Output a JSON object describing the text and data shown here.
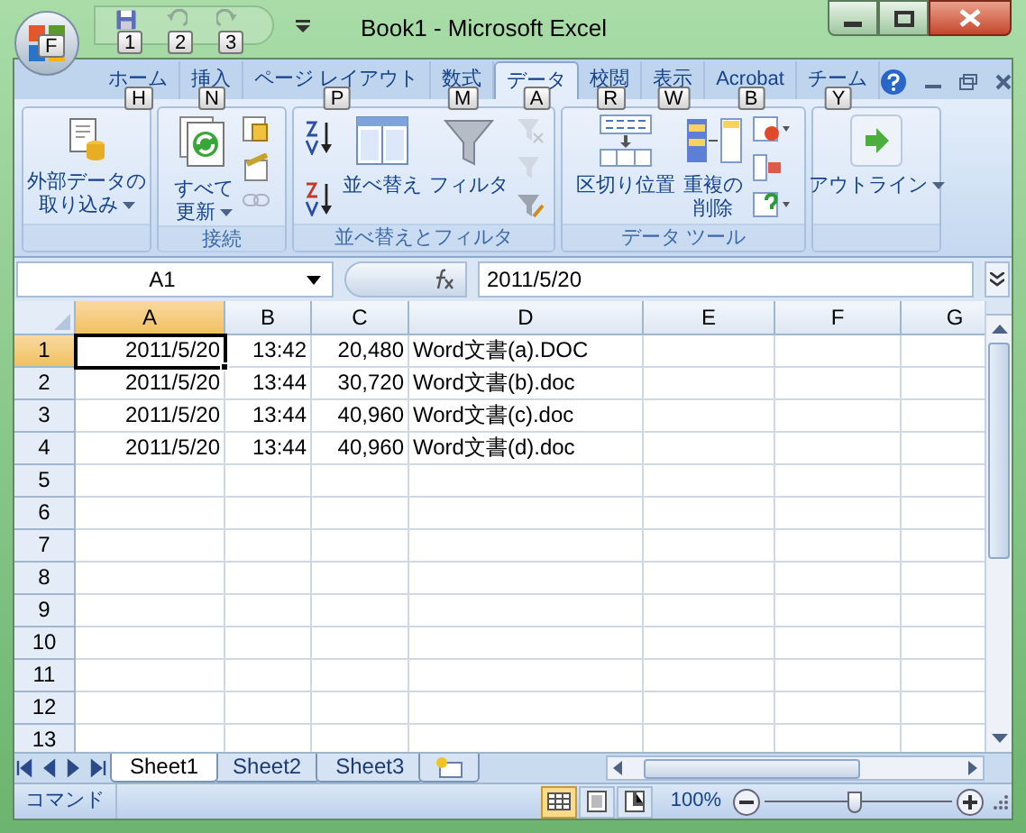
{
  "window": {
    "title": "Book1 - Microsoft Excel"
  },
  "office_button": {
    "keytip": "F"
  },
  "quick_access": [
    {
      "keytip": "1",
      "disabled": false
    },
    {
      "keytip": "2",
      "disabled": true
    },
    {
      "keytip": "3",
      "disabled": true
    }
  ],
  "tabs": [
    {
      "label": "ホーム",
      "keytip": "H",
      "selected": false
    },
    {
      "label": "挿入",
      "keytip": "N",
      "selected": false
    },
    {
      "label": "ページ レイアウト",
      "keytip": "P",
      "selected": false
    },
    {
      "label": "数式",
      "keytip": "M",
      "selected": false
    },
    {
      "label": "データ",
      "keytip": "A",
      "selected": true
    },
    {
      "label": "校閲",
      "keytip": "R",
      "selected": false
    },
    {
      "label": "表示",
      "keytip": "W",
      "selected": false
    },
    {
      "label": "Acrobat",
      "keytip": "B",
      "selected": false
    },
    {
      "label": "チーム",
      "keytip": "Y",
      "selected": false
    }
  ],
  "ribbon_groups": [
    {
      "buttons": [
        {
          "kind": "import",
          "label": "外部データの取り込み",
          "dropdown": true
        }
      ]
    },
    {
      "label": "接続",
      "buttons": [
        {
          "kind": "refresh",
          "label": "すべて更新",
          "dropdown": true
        },
        {
          "kind": "connections-small"
        }
      ]
    },
    {
      "label": "並べ替えとフィルタ",
      "buttons": [
        {
          "kind": "sort-small"
        },
        {
          "kind": "sort",
          "label": "並べ替え",
          "dropdown": false
        },
        {
          "kind": "filter",
          "label": "フィルタ",
          "dropdown": false
        },
        {
          "kind": "filter-small"
        }
      ]
    },
    {
      "label": "データ ツール",
      "buttons": [
        {
          "kind": "split",
          "label": "区切り位置",
          "dropdown": false
        },
        {
          "kind": "dedupe",
          "label": "重複の削除",
          "dropdown": false
        },
        {
          "kind": "tools-small"
        }
      ]
    },
    {
      "buttons": [
        {
          "kind": "outline",
          "label": "アウトライン",
          "dropdown": true
        }
      ]
    }
  ],
  "formula_bar": {
    "name_box": "A1",
    "value": "2011/5/20"
  },
  "columns": [
    {
      "label": "A",
      "selected": true
    },
    {
      "label": "B",
      "selected": false
    },
    {
      "label": "C",
      "selected": false
    },
    {
      "label": "D",
      "selected": false
    },
    {
      "label": "E",
      "selected": false
    },
    {
      "label": "F",
      "selected": false
    },
    {
      "label": "G",
      "selected": false
    }
  ],
  "rows": [
    {
      "header": "1",
      "selected": true,
      "cells": [
        {
          "text": "2011/5/20",
          "active": true
        },
        {
          "text": "13:42",
          "active": false
        },
        {
          "text": "20,480",
          "active": false
        },
        {
          "text": "Word文書(a).DOC",
          "active": false
        }
      ]
    },
    {
      "header": "2",
      "selected": false,
      "cells": [
        {
          "text": "2011/5/20",
          "active": false
        },
        {
          "text": "13:44",
          "active": false
        },
        {
          "text": "30,720",
          "active": false
        },
        {
          "text": "Word文書(b).doc",
          "active": false
        }
      ]
    },
    {
      "header": "3",
      "selected": false,
      "cells": [
        {
          "text": "2011/5/20",
          "active": false
        },
        {
          "text": "13:44",
          "active": false
        },
        {
          "text": "40,960",
          "active": false
        },
        {
          "text": "Word文書(c).doc",
          "active": false
        }
      ]
    },
    {
      "header": "4",
      "selected": false,
      "cells": [
        {
          "text": "2011/5/20",
          "active": false
        },
        {
          "text": "13:44",
          "active": false
        },
        {
          "text": "40,960",
          "active": false
        },
        {
          "text": "Word文書(d).doc",
          "active": false
        }
      ]
    },
    {
      "header": "5",
      "selected": false
    },
    {
      "header": "6",
      "selected": false
    },
    {
      "header": "7",
      "selected": false
    },
    {
      "header": "8",
      "selected": false
    },
    {
      "header": "9",
      "selected": false
    },
    {
      "header": "10",
      "selected": false
    },
    {
      "header": "11",
      "selected": false
    },
    {
      "header": "12",
      "selected": false
    },
    {
      "header": "13",
      "selected": false
    }
  ],
  "sheet_tabs": [
    {
      "label": "Sheet1",
      "selected": true
    },
    {
      "label": "Sheet2",
      "selected": false
    },
    {
      "label": "Sheet3",
      "selected": false
    }
  ],
  "status_bar": {
    "mode": "コマンド",
    "views": [
      {
        "kind": "normal",
        "selected": true
      },
      {
        "kind": "page-layout",
        "selected": false
      },
      {
        "kind": "page-break",
        "selected": false
      }
    ],
    "zoom": "100%",
    "zoom_level": {
      "level": 0.5
    }
  }
}
